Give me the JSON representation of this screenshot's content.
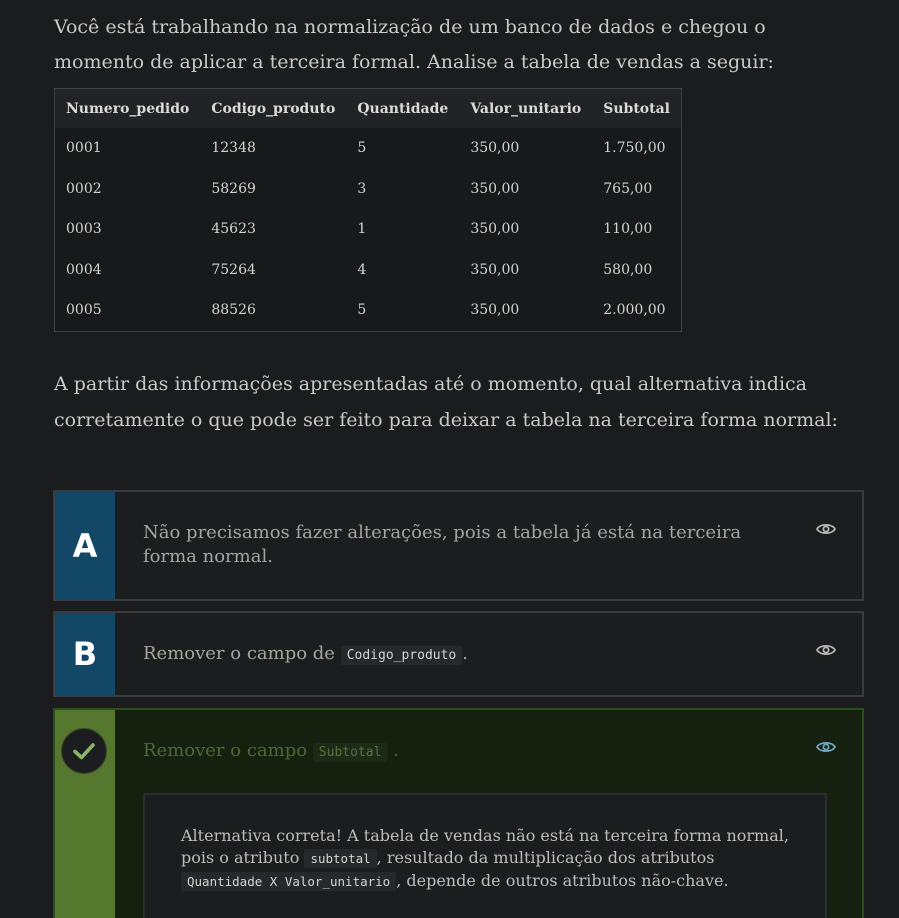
{
  "intro": {
    "line1": "Você está trabalhando na normalização de um banco de dados e chegou o",
    "line2": "momento de aplicar a terceira formal. Analise a tabela de vendas a seguir:"
  },
  "table": {
    "headers": [
      "Numero_pedido",
      "Codigo_produto",
      "Quantidade",
      "Valor_unitario",
      "Subtotal"
    ],
    "rows": [
      [
        "0001",
        "12348",
        "5",
        "350,00",
        "1.750,00"
      ],
      [
        "0002",
        "58269",
        "3",
        "350,00",
        "765,00"
      ],
      [
        "0003",
        "45623",
        "1",
        "350,00",
        "110,00"
      ],
      [
        "0004",
        "75264",
        "4",
        "350,00",
        "580,00"
      ],
      [
        "0005",
        "88526",
        "5",
        "350,00",
        "2.000,00"
      ]
    ]
  },
  "question": {
    "line1": "A partir das informações apresentadas até o momento, qual alternativa indica",
    "line2": "corretamente o que pode ser feito para deixar a tabela na terceira forma normal:"
  },
  "options": {
    "a": {
      "letter": "A",
      "text": "Não precisamos fazer alterações, pois a tabela já está na terceira forma normal."
    },
    "b": {
      "letter": "B",
      "text_before": "Remover o campo de",
      "code": "Codigo_produto",
      "text_after": "."
    },
    "c": {
      "text_before": "Remover o campo",
      "code": "Subtotal",
      "text_after": ".",
      "feedback": {
        "part1": "Alternativa correta! A tabela de vendas não está na terceira forma normal, pois o atributo",
        "code1": "subtotal",
        "part2": ", resultado da multiplicação dos atributos",
        "code2": "Quantidade X Valor_unitario",
        "part3": ", depende de outros atributos não-chave."
      }
    }
  },
  "colors": {
    "letter_bg": "#124766",
    "correct_bg": "#56772e",
    "correct_text": "#4c6a35",
    "eye_correct": "#6fa7c2"
  },
  "icons": {
    "eye": "eye-icon",
    "check": "check-icon"
  }
}
